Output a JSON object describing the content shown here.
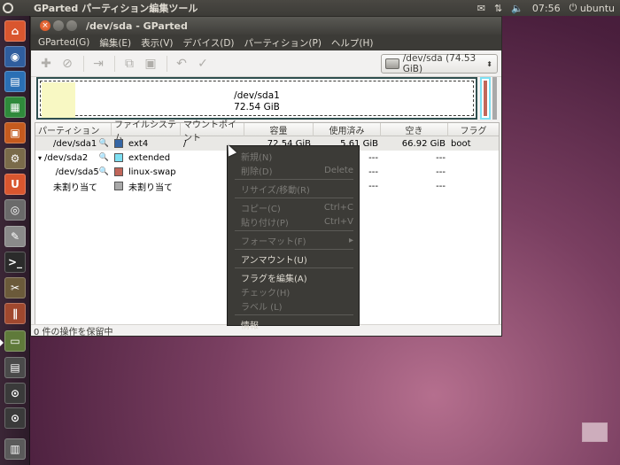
{
  "top_panel": {
    "app_title": "GParted パーティション編集ツール",
    "mail_icon": "mail-icon",
    "time": "07:56",
    "user": "ubuntu"
  },
  "launcher": {
    "items": [
      "home-folder-icon",
      "firefox-icon",
      "writer-icon",
      "calc-icon",
      "impress-icon",
      "settings-icon",
      "software-center-icon",
      "screenshot-icon",
      "text-editor-icon",
      "terminal-icon",
      "tools-icon",
      "colors-icon",
      "gparted-icon",
      "window-icon",
      "search-icon",
      "search-icon-2",
      "trash-icon"
    ]
  },
  "window": {
    "title": "/dev/sda - GParted",
    "menu": [
      "GParted(G)",
      "編集(E)",
      "表示(V)",
      "デバイス(D)",
      "パーティション(P)",
      "ヘルプ(H)"
    ],
    "device_select": "/dev/sda  (74.53 GiB)",
    "disk_graph": {
      "device": "/dev/sda1",
      "size": "72.54 GiB"
    },
    "status": "0 件の操作を保留中"
  },
  "table": {
    "headers": [
      "パーティション",
      "ファイルシステム",
      "マウントポイント",
      "容量",
      "使用済み",
      "空き",
      "フラグ"
    ],
    "rows": [
      {
        "partition": "/dev/sda1",
        "fs": "ext4",
        "fs_color": "#3465a4",
        "mount": "/",
        "size": "72.54 GiB",
        "used": "5.61 GiB",
        "free": "66.92 GiB",
        "flags": "boot",
        "key": true,
        "expander": ""
      },
      {
        "partition": "/dev/sda2",
        "fs": "extended",
        "fs_color": "#7ee0f3",
        "mount": "",
        "size": "",
        "used": "---",
        "free": "---",
        "flags": "",
        "key": true,
        "expander": "▾"
      },
      {
        "partition": "/dev/sda5",
        "fs": "linux-swap",
        "fs_color": "#c1665a",
        "mount": "",
        "size": "",
        "used": "---",
        "free": "---",
        "flags": "",
        "key": true,
        "expander": ""
      },
      {
        "partition": "未割り当て",
        "fs": "未割り当て",
        "fs_color": "#a9a9a9",
        "mount": "",
        "size": "",
        "used": "---",
        "free": "---",
        "flags": "",
        "key": false,
        "expander": ""
      }
    ]
  },
  "context_menu": {
    "items": [
      {
        "label": "新規(N)",
        "enabled": false,
        "accel": ""
      },
      {
        "label": "削除(D)",
        "enabled": false,
        "accel": "Delete"
      },
      {
        "sep": true
      },
      {
        "label": "リサイズ/移動(R)",
        "enabled": false,
        "accel": ""
      },
      {
        "sep": true
      },
      {
        "label": "コピー(C)",
        "enabled": false,
        "accel": "Ctrl+C"
      },
      {
        "label": "貼り付け(P)",
        "enabled": false,
        "accel": "Ctrl+V"
      },
      {
        "sep": true
      },
      {
        "label": "フォーマット(F)",
        "enabled": false,
        "accel": "▸"
      },
      {
        "sep": true
      },
      {
        "label": "アンマウント(U)",
        "enabled": true,
        "accel": ""
      },
      {
        "sep": true
      },
      {
        "label": "フラグを編集(A)",
        "enabled": true,
        "accel": ""
      },
      {
        "label": "チェック(H)",
        "enabled": false,
        "accel": ""
      },
      {
        "label": "ラベル (L)",
        "enabled": false,
        "accel": ""
      },
      {
        "sep": true
      },
      {
        "label": "情報",
        "enabled": true,
        "accel": ""
      }
    ]
  }
}
